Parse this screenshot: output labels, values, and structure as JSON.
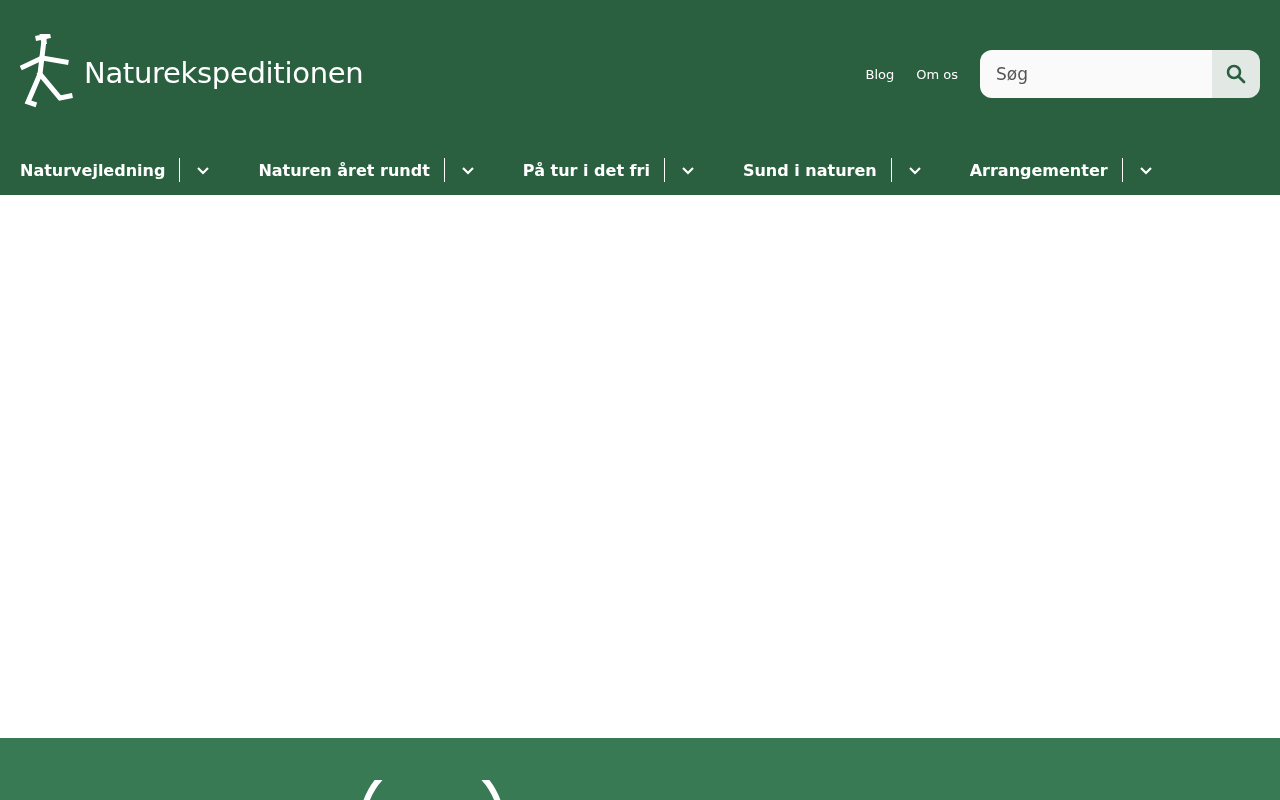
{
  "logo": {
    "text": "Naturekspeditionen"
  },
  "top_links": [
    "Blog",
    "Om os"
  ],
  "search": {
    "placeholder": "Søg"
  },
  "nav": [
    {
      "label": "Naturvejledning",
      "expanded": false
    },
    {
      "label": "Naturen året rundt",
      "expanded": false
    },
    {
      "label": "På tur i det fri",
      "expanded": false
    },
    {
      "label": "Sund i naturen",
      "expanded": false
    },
    {
      "label": "Arrangementer",
      "expanded": false
    }
  ]
}
